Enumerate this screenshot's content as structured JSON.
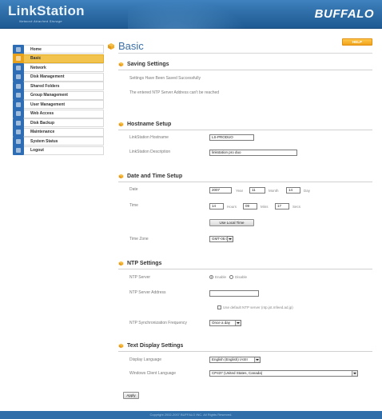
{
  "header": {
    "logo": "LinkStation",
    "logo_tag": "Network Attached Storage",
    "brand": "BUFFALO"
  },
  "sidebar": {
    "items": [
      {
        "label": "Home",
        "icon": "house-icon",
        "color": "#2e6db4"
      },
      {
        "label": "Basic",
        "icon": "wrench-icon",
        "color": "#e8a21c",
        "active": true
      },
      {
        "label": "Network",
        "icon": "network-icon",
        "color": "#2e6db4"
      },
      {
        "label": "Disk Management",
        "icon": "disk-icon",
        "color": "#2e6db4"
      },
      {
        "label": "Shared Folders",
        "icon": "folder-icon",
        "color": "#2e6db4"
      },
      {
        "label": "Group Management",
        "icon": "group-icon",
        "color": "#2e6db4"
      },
      {
        "label": "User Management",
        "icon": "user-icon",
        "color": "#2e6db4"
      },
      {
        "label": "Web Access",
        "icon": "globe-icon",
        "color": "#2e6db4"
      },
      {
        "label": "Disk Backup",
        "icon": "backup-icon",
        "color": "#2e6db4"
      },
      {
        "label": "Maintenance",
        "icon": "tools-icon",
        "color": "#2e6db4"
      },
      {
        "label": "System Status",
        "icon": "status-icon",
        "color": "#2e6db4"
      },
      {
        "label": "Logout",
        "icon": "logout-icon",
        "color": "#2e6db4"
      }
    ]
  },
  "main": {
    "title": "Basic",
    "help_label": "HELP",
    "saving": {
      "heading": "Saving Settings",
      "msg1": "Settings Have Been Saved Successfully",
      "msg2": "The entered NTP Server Address can't be reached"
    },
    "hostname": {
      "heading": "Hostname Setup",
      "hostname_label": "LinkStation Hostname",
      "hostname_value": "LS-PRODUO",
      "desc_label": "LinkStation Description",
      "desc_value": "linkstation pro duo"
    },
    "datetime": {
      "heading": "Date and Time Setup",
      "date_label": "Date",
      "year": "2007",
      "year_unit": "Year",
      "month": "11",
      "month_unit": "Month",
      "day": "14",
      "day_unit": "Day",
      "time_label": "Time",
      "hours": "14",
      "hours_unit": "Hours",
      "mins": "09",
      "mins_unit": "Mins",
      "secs": "17",
      "secs_unit": "Secs",
      "local_time_btn": "Use Local Time",
      "timezone_label": "Time Zone",
      "timezone_value": "GMT-05:00"
    },
    "ntp": {
      "heading": "NTP Settings",
      "server_label": "NTP Server",
      "enable_label": "Enable",
      "disable_label": "Disable",
      "address_label": "NTP Server Address",
      "address_value": "",
      "default_label": "Use default NTP server (ntp.jst.mfeed.ad.jp)",
      "freq_label": "NTP Synchronization Frequency",
      "freq_value": "Once a day"
    },
    "text_display": {
      "heading": "Text Display Settings",
      "display_lang_label": "Display Language",
      "display_lang_value": "English (English) /ASII",
      "client_lang_label": "Windows Client Language",
      "client_lang_value": "CP437 (United States, Canada)"
    },
    "apply_label": "Apply"
  },
  "footer": {
    "copyright": "Copyright 2002-2007 BUFFALO INC. All Rights Reserved."
  }
}
